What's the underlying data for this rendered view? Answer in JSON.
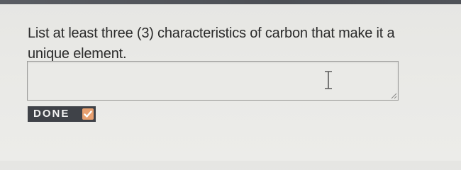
{
  "question": {
    "text": "List at least three (3) characteristics of carbon that make it a unique element."
  },
  "answer": {
    "value": ""
  },
  "done_button": {
    "label": "DONE",
    "icon": "checkmark-icon"
  },
  "icons": {
    "text_cursor": "text-cursor-icon",
    "resize_handle": "resize-handle-icon"
  },
  "colors": {
    "button_bg": "#3f4248",
    "check_badge": "#e8a070",
    "page_bg": "#e9e9e6"
  }
}
